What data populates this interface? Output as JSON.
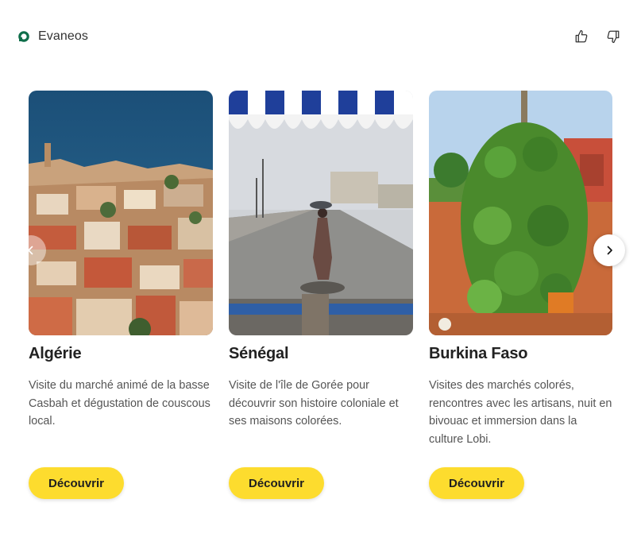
{
  "header": {
    "brand_name": "Evaneos",
    "brand_icon": "evaneos-logo-icon",
    "brand_color": "#0f6e4a"
  },
  "feedback": {
    "like_icon": "thumbs-up-icon",
    "dislike_icon": "thumbs-down-icon"
  },
  "carousel": {
    "prev_icon": "chevron-left-icon",
    "next_icon": "chevron-right-icon",
    "cards": [
      {
        "title": "Algérie",
        "description": "Visite du marché animé de la basse Casbah et dégustation de couscous local.",
        "button_label": "Découvrir",
        "image": "algeria-coastal-town-photo"
      },
      {
        "title": "Sénégal",
        "description": "Visite de l'île de Gorée pour découvrir son histoire coloniale et ses maisons colorées.",
        "button_label": "Découvrir",
        "image": "senegal-street-photo"
      },
      {
        "title": "Burkina Faso",
        "description": "Visites des marchés colorés, rencontres avec les artisans, nuit en bivouac et immersion dans la culture Lobi.",
        "button_label": "Découvrir",
        "image": "burkina-faso-plant-wall-photo"
      }
    ]
  },
  "colors": {
    "button_bg": "#fddc2e",
    "title_text": "#222222",
    "desc_text": "#555555"
  }
}
